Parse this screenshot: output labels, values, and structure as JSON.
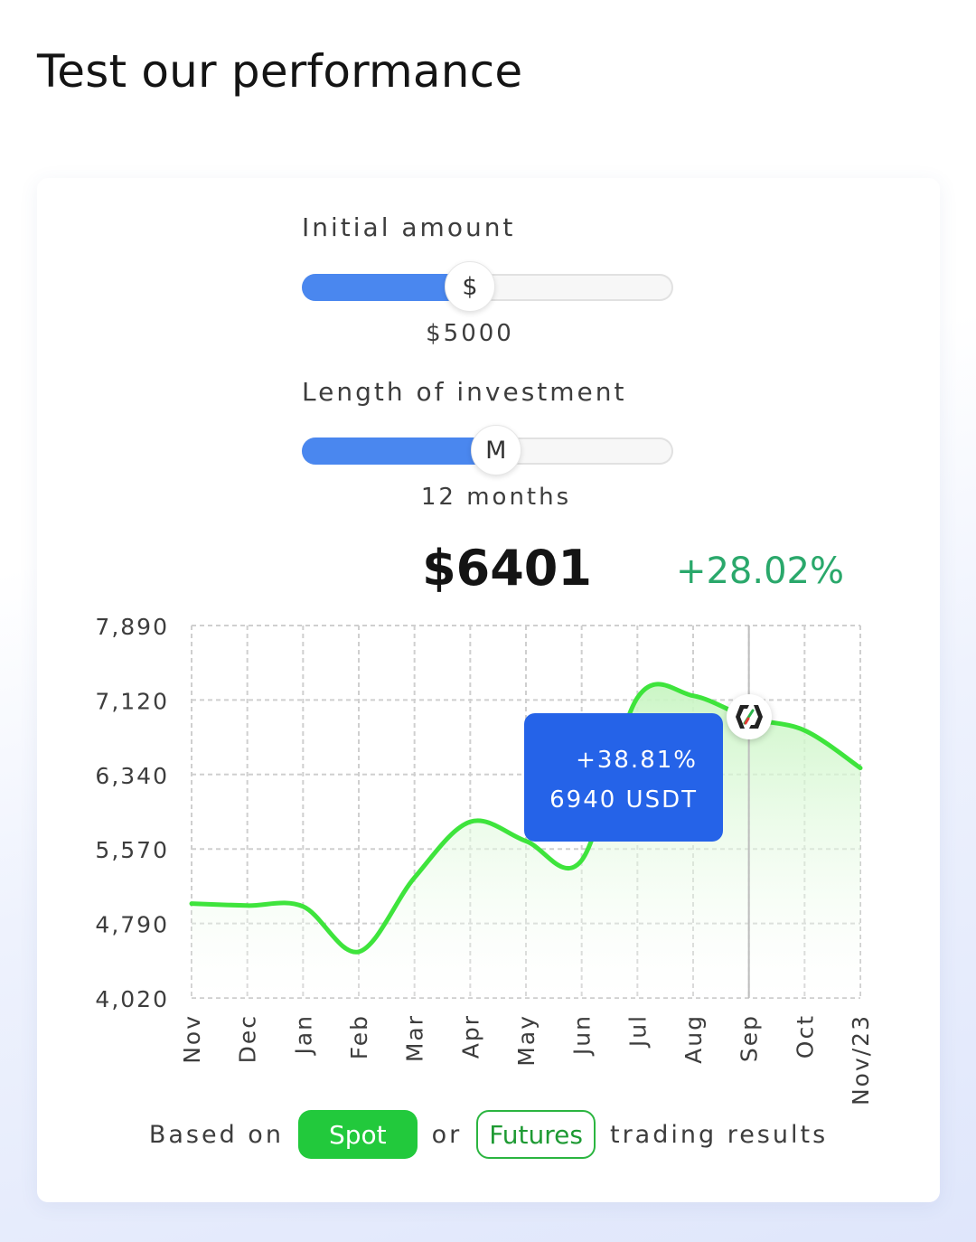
{
  "page": {
    "title": "Test our performance"
  },
  "calculator": {
    "initial_amount": {
      "label": "Initial amount",
      "thumb_symbol": "$",
      "value": "$5000",
      "fill_fraction": 0.45
    },
    "length": {
      "label": "Length of investment",
      "thumb_symbol": "M",
      "value": "12 months",
      "fill_fraction": 0.52
    },
    "result": {
      "amount": "$6401",
      "change": "+28.02%"
    }
  },
  "tooltip": {
    "change": "+38.81%",
    "value": "6940 USDT"
  },
  "footer": {
    "prefix": "Based on",
    "spot_label": "Spot",
    "or": "or",
    "futures_label": "Futures",
    "suffix": "trading results"
  },
  "colors": {
    "line": "#3ee43c",
    "fill": "#d6f7d2",
    "slider": "#4a87ef",
    "tooltip": "#2563e8",
    "positive": "#2aa86b",
    "spot_button": "#22c93c"
  },
  "chart_data": {
    "type": "area",
    "x": [
      "Nov",
      "Dec",
      "Jan",
      "Feb",
      "Mar",
      "Apr",
      "May",
      "Jun",
      "Jul",
      "Aug",
      "Sep",
      "Oct",
      "Nov/23"
    ],
    "y_ticks": [
      "7,890",
      "7,120",
      "6,340",
      "5,570",
      "4,790",
      "4,020"
    ],
    "ylim": [
      4020,
      7890
    ],
    "values": [
      5000,
      4980,
      4970,
      4500,
      5270,
      5850,
      5650,
      5450,
      7140,
      7160,
      6930,
      6800,
      6410
    ],
    "highlight_index": 10,
    "grid": true
  }
}
